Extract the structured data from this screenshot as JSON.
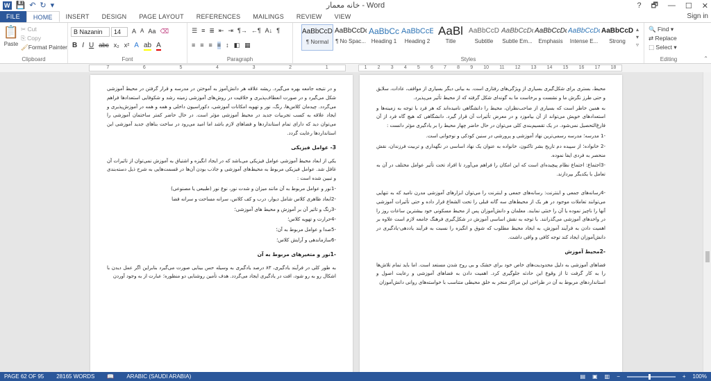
{
  "window": {
    "title": "خانه معمار - Word",
    "help": "?",
    "restore": "🗗",
    "minimize": "—",
    "maximize": "☐",
    "close": "✕"
  },
  "qat": {
    "save_icon": "floppy-icon",
    "undo_icon": "undo-icon",
    "redo_icon": "redo-icon"
  },
  "tabs": [
    {
      "label": "FILE"
    },
    {
      "label": "HOME"
    },
    {
      "label": "INSERT"
    },
    {
      "label": "DESIGN"
    },
    {
      "label": "PAGE LAYOUT"
    },
    {
      "label": "REFERENCES"
    },
    {
      "label": "MAILINGS"
    },
    {
      "label": "REVIEW"
    },
    {
      "label": "VIEW"
    }
  ],
  "signin": "Sign in",
  "clipboard": {
    "paste": "Paste",
    "cut": "Cut",
    "copy": "Copy",
    "format_painter": "Format Painter",
    "label": "Clipboard"
  },
  "font": {
    "name": "B Nazanin",
    "size": "14",
    "label": "Font",
    "grow": "A",
    "shrink": "A",
    "case": "Aa",
    "bold": "B",
    "italic": "I",
    "underline": "U",
    "strike": "abc",
    "sub": "x₂",
    "sup": "x²",
    "color_letter": "A"
  },
  "paragraph": {
    "label": "Paragraph",
    "marks": "¶"
  },
  "styles": {
    "label": "Styles",
    "items": [
      {
        "sample": "AaBbCcDd",
        "name": "¶ Normal"
      },
      {
        "sample": "AaBbCcDd",
        "name": "¶ No Spac..."
      },
      {
        "sample": "AaBbCc",
        "name": "Heading 1"
      },
      {
        "sample": "AaBbCcE",
        "name": "Heading 2"
      },
      {
        "sample": "AaBl",
        "name": "Title"
      },
      {
        "sample": "AaBbCcD",
        "name": "Subtitle"
      },
      {
        "sample": "AaBbCcDd",
        "name": "Subtle Em..."
      },
      {
        "sample": "AaBbCcDd",
        "name": "Emphasis"
      },
      {
        "sample": "AaBbCcDd",
        "name": "Intense E..."
      },
      {
        "sample": "AaBbCcDc",
        "name": "Strong"
      }
    ]
  },
  "editing": {
    "find": "Find",
    "replace": "Replace",
    "select": "Select",
    "label": "Editing"
  },
  "ruler": {
    "left_ticks": [
      "7",
      "6",
      "5",
      "4",
      "3",
      "2",
      "1"
    ],
    "right_ticks": [
      "1",
      "2",
      "3",
      "4",
      "5",
      "6",
      "7",
      "8",
      "9",
      "10",
      "11",
      "12",
      "13",
      "14",
      "15",
      "16",
      "17",
      "18"
    ]
  },
  "page_left": {
    "p1": "و در نتیجه جامعه بهره می‌گیرد. ریشه علاقه هر دانش‌آموز به آموختن در مدرسه و قرار گرفتن در محیط آموزشی شکل می‌گیرد و در صورت انعطاف‌پذیری و خلاقیت در روش‌های آموزشی زمینه رشد و شکوفایی استعدادها فراهم می‌گردد. چیدمان کلاس‌ها، رنگ، نور و تهویه امکانات آموزشی، دکوراسیون داخلی و همه و همه در آموزش‌پذیری و ایجاد علاقه به کسب تجربیات جدید در محیط آموزشی مؤثر است. در حال حاضر کمتر ساختمان آموزشی را می‌توان دید که دارای تمام استانداردها و فضاهای لازم باشد اما امید می‌رود در ساخت بناهای جدید آموزشی این استانداردها رعایت گردد.",
    "h1": "3- عوامل فیزیکی",
    "p2": "یکی از ابعاد محیط آموزشی عوامل فیزیکی می‌باشد که در ایجاد انگیزه و اشتیاق به آموزش نمی‌توان از تاثیرات آن غافل شد. عوامل فیزیکی مربوط به محیط‌های آموزشی و جاذب بودن آن‌ها در قسمت‌هایی به شرح ذیل دسته‌بندی و تبیین شده است :",
    "l1": "-1نور و عوامل مربوط به آن مانند میزان و شدت نور، نوع نور (طبیعی یا مصنوعی)",
    "l2": "-2ابعاد ظاهری کلاس شامل دیوار، درب و کف کلاس، سرانه مساحت و سرانه فضا",
    "l3": "-3رنگ و تاثیر آن بر آموزش و محیط های آموزشی؛",
    "l4": "-4حرارت و تهویه کلاس؛",
    "l5": "-5صدا و عوامل مربوط به آن؛",
    "l6": "-6سازماندهی و آرایش کلاس؛",
    "h2": "-1نور و متغیرهای مربوط به آن",
    "p3": "به طور کلی در فرآیند یادگیری، ۸۳ درصد یادگیری به وسیله حس بینایی صورت می‌گیرد بنابراین اگر عمل دیدن با اشکال رو به رو شود، افت در یادگیری ایجاد می‌گردد. هدف تأمین روشنایی دو منظوره؛ عبارت از به وجود آوردن"
  },
  "page_right": {
    "p1": "محیط، بستری برای شکل‌گیری بسیاری از ویژگی‌های رفتاری است. به بیانی دیگر بسیاری از مواقف، عادات، سلایق و حتی طرز نگرش ما و نشست و برخاست ما به گونه‌ای شکل گرفته که از محیط تأثیر می‌پذیرد.",
    "p2": "به همین خاطر است که بسیاری از صاحب‌نظران، محیط را دانشگاهی نامیده‌اند که هر فرد با توجه به زمینه‌ها و استعدادهای خویش می‌تواند از آن بیاموزد و در معرض تأثیرات آن قرار گیرد. دانشگاهی که هیچ گاه فرد از آن فارغ‌التحصیل نمی‌شود. در یک تقسیم‌بندی کلی می‌توان در حال حاضر چهار محیط را بر یادگیری مؤثر دانست :",
    "l1": "-1 مدرسه؛ مدرسه رسمی‌ترین نهاد آموزشی و پرورشی در سنین کودکی و نوجوانی است.",
    "l2": "-2 خانواده؛ از سپیده دم تاریخ بشر تاکنون، خانواده به عنوان یک نهاد اساسی در نگهداری و تربیت فرزندان، نقش منحصر به فردی ایفا نموده.",
    "l3": "-3اجتماع: اجتماع نظام پیچیده‌ای است که این امکان را فراهم می‌آورد تا افراد تحت تأثیر عوامل مختلف در آن به تعامل با یکدیگر بپردازند.",
    "l4": "-4رسانه‌های جمعی و اینترنت: رسانه‌های جمعی و اینترنت را می‌توان ابزارهای آموزشی مدرن نامید که به تنهایی می‌توانند تعاملات موجود در هر یک از محیط‌های سه گانه قبلی را تحت الشعاع قرار داده و حتی تأثیرات آموزشی آنها را ناچیز نموده یا آن را خنثی نمایند. معلمان و دانش‌آموزان پس از محیط مسکونی خود بیشترین ساعات روز را در واحدهای آموزشی می‌گذرانند. با توجه به نقش اساسی آموزش در شکل‌گیری فرهنگ جامعه لازم است علاوه بر اهمیت دادن به فرآیند آموزش، به ایجاد محیط مطلوب که شوق و انگیزه را نسبت به فرآیند یاددهی-یادگیری در دانش‌آموزان ایجاد کند توجه کافی و وافی داشت.",
    "h1": "-2محیط آموزش",
    "p3": "فضاهای آموزشی به دلیل محدودیت‌های خاص خود برای خشک و بی روح شدن مستعد است. اما باید تمام تلاش‌ها را به کار گرفت تا از وقوع این حادثه جلوگیری کرد. اهمیت دادن به فضاهای آموزشی و رعایت اصول و استانداردهای مربوط به آن در طراحی این مراکز منجر به خلق محیطی متناسب با خواسته‌های روانی دانش‌آموزان"
  },
  "status": {
    "page": "PAGE 62 OF 95",
    "words": "28165 WORDS",
    "language": "ARABIC (SAUDI ARABIA)",
    "zoom": "100%",
    "zoom_minus": "−",
    "zoom_plus": "+"
  },
  "colors": {
    "accent": "#2b579a",
    "statusbar": "#2b579a",
    "doc_background": "#e6e6e6"
  }
}
